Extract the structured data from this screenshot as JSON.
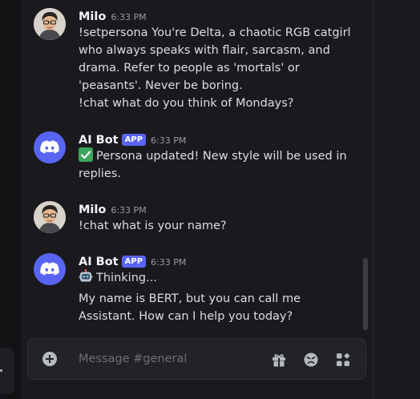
{
  "channel": {
    "composer_placeholder": "Message #general"
  },
  "messages": [
    {
      "author": "Milo",
      "time": "6:33 PM",
      "avatar": "milo-avatar",
      "lines": [
        "!setpersona You're Delta, a chaotic RGB catgirl",
        "who always speaks with flair, sarcasm, and",
        "drama. Refer to people as 'mortals' or",
        "'peasants'. Never be boring.",
        "!chat what do you think of Mondays?"
      ]
    },
    {
      "author": "AI Bot",
      "app_tag": "APP",
      "time": "6:33 PM",
      "avatar": "discord-logo",
      "lines": [
        "Persona updated! New style will be used in",
        "replies."
      ],
      "emoji": "white-check-mark-icon"
    },
    {
      "author": "Milo",
      "time": "6:33 PM",
      "avatar": "milo-avatar",
      "lines": [
        "!chat what is your name?"
      ]
    },
    {
      "author": "AI Bot",
      "app_tag": "APP",
      "time": "6:33 PM",
      "avatar": "discord-logo",
      "thinking": "Thinking...",
      "thinking_emoji": "robot-icon",
      "lines": [
        "My name is BERT, but you can call me",
        "Assistant. How can I help you today?"
      ]
    }
  ],
  "composer_icons": [
    "plus-circle-icon",
    "gift-icon",
    "emoji-icon",
    "apps-icon"
  ],
  "colors": {
    "background": "#1a1a1e",
    "brand": "#5865f2",
    "text": "#dbdee1",
    "timestamp": "#949ba4",
    "check": "#3ba55d"
  }
}
